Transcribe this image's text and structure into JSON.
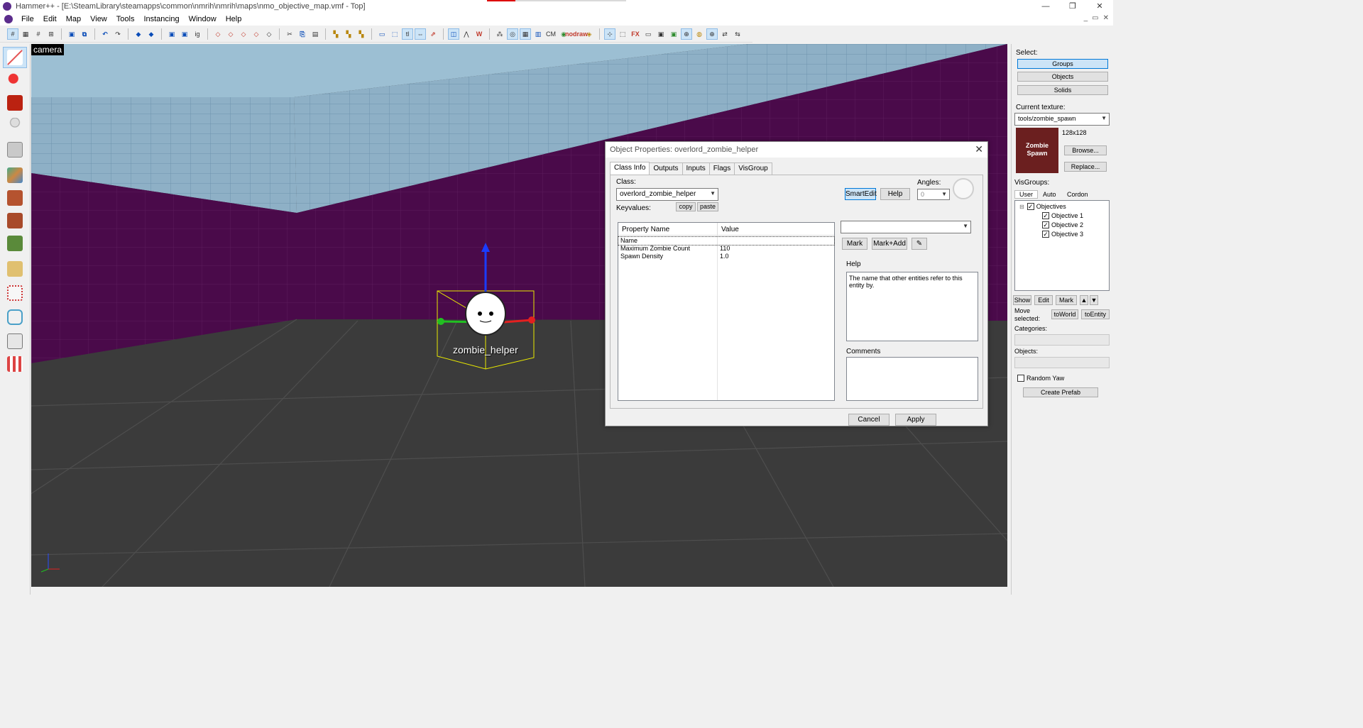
{
  "window": {
    "title": "Hammer++ - [E:\\SteamLibrary\\steamapps\\common\\nmrih\\nmrih\\maps\\nmo_objective_map.vmf - Top]",
    "controls": [
      "—",
      "❐",
      "✕"
    ]
  },
  "menu": [
    "File",
    "Edit",
    "Map",
    "View",
    "Tools",
    "Instancing",
    "Window",
    "Help"
  ],
  "mdi_controls": [
    "_",
    "▭",
    "✕"
  ],
  "toolbar": {
    "glyphs": [
      "#",
      "▦",
      "#",
      "⊞",
      "▣",
      "⧉",
      "↶",
      "↷",
      "◆",
      "◆",
      "▣",
      "▣",
      "ig",
      "◇",
      "◇",
      "◇",
      "◇",
      "◇",
      "✂",
      "⎘",
      "▤",
      "▚",
      "▚",
      "▚",
      "▭",
      "⬚",
      "tl",
      "⇔",
      "⇗",
      "◫",
      "⋀",
      "W",
      "⁂",
      "◎",
      "▦",
      "▥",
      "CM",
      "◉",
      "nodraw",
      "◈",
      "⊹",
      "⬚",
      "FX",
      "▭",
      "▣",
      "▣",
      "⊕",
      "◍",
      "⊕",
      "⇄",
      "⇆"
    ]
  },
  "viewport": {
    "label": "camera",
    "entity_label": "zombie_helper"
  },
  "dialog": {
    "title": "Object Properties: overlord_zombie_helper",
    "tabs": [
      "Class Info",
      "Outputs",
      "Inputs",
      "Flags",
      "VisGroup"
    ],
    "class_label": "Class:",
    "class_value": "overlord_zombie_helper",
    "keyvalues_label": "Keyvalues:",
    "copy": "copy",
    "paste": "paste",
    "smartedit": "SmartEdit",
    "help_btn": "Help",
    "angles_label": "Angles:",
    "angles_value": "0",
    "columns": [
      "Property Name",
      "Value"
    ],
    "rows": [
      {
        "name": "Name",
        "value": ""
      },
      {
        "name": "Maximum Zombie Count",
        "value": "110"
      },
      {
        "name": "Spawn Density",
        "value": "1.0"
      }
    ],
    "mark": "Mark",
    "mark_add": "Mark+Add",
    "help_label": "Help",
    "help_text": "The name that other entities refer to this entity by.",
    "comments_label": "Comments",
    "cancel": "Cancel",
    "apply": "Apply"
  },
  "right_panel": {
    "select_label": "Select:",
    "select_buttons": [
      "Groups",
      "Objects",
      "Solids"
    ],
    "current_texture_label": "Current texture:",
    "texture": "tools/zombie_spawn",
    "texture_size": "128x128",
    "texture_preview_text": "Zombie Spawn",
    "browse": "Browse...",
    "replace": "Replace...",
    "visgroups_label": "VisGroups:",
    "vg_tabs": [
      "User",
      "Auto",
      "Cordon"
    ],
    "visgroups": [
      "Objectives",
      "Objective 1",
      "Objective 2",
      "Objective 3"
    ],
    "vg_buttons": [
      "Show",
      "Edit",
      "Mark"
    ],
    "move_selected": "Move selected:",
    "to_world": "toWorld",
    "to_entity": "toEntity",
    "categories_label": "Categories:",
    "objects_label": "Objects:",
    "random_yaw": "Random Yaw",
    "create_prefab": "Create Prefab"
  },
  "colors": {
    "wall_purple": "#4a0a4a",
    "ceiling_blue": "#8fb3cc",
    "floor_gray": "#3b3b3b",
    "accent": "#0078d7"
  }
}
